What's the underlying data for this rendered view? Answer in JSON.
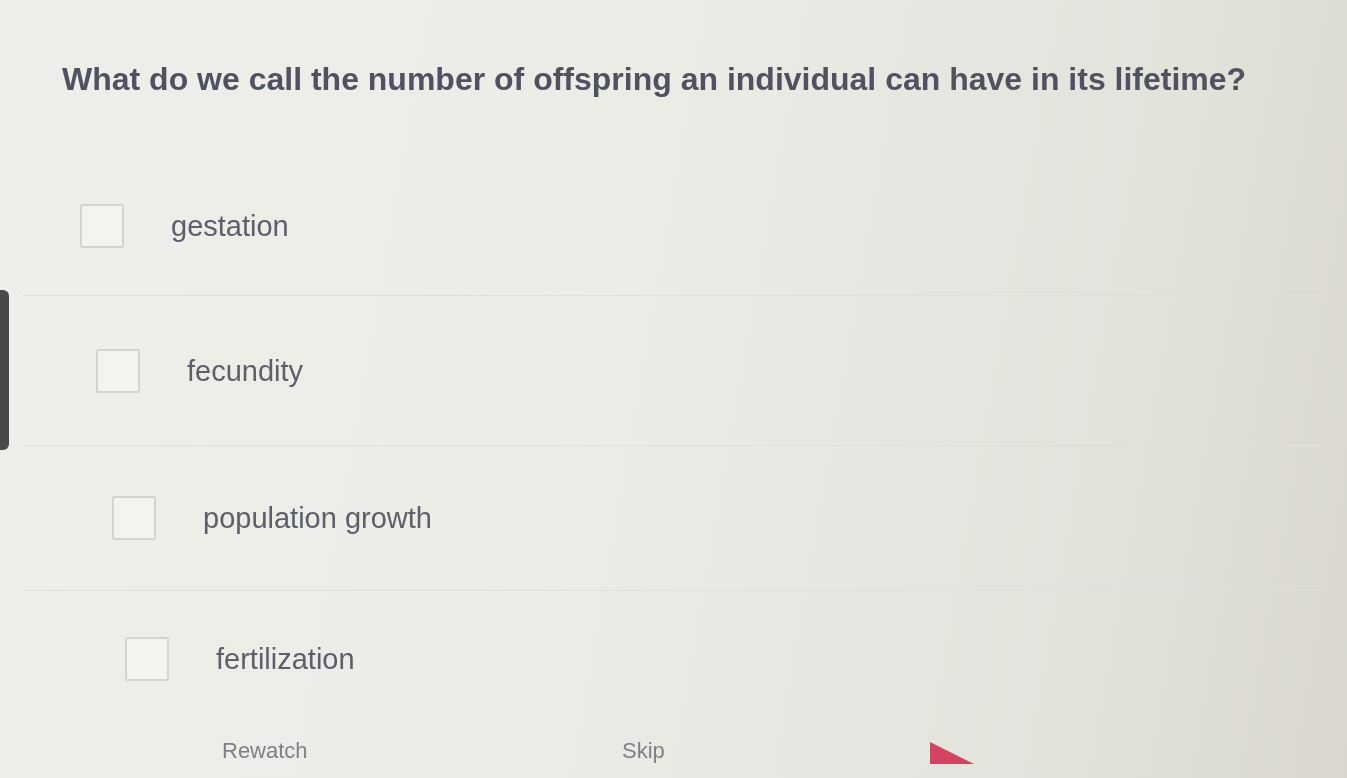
{
  "question": "What do we call the number of offspring an individual can have in its lifetime?",
  "options": [
    {
      "label": "gestation",
      "checked": false
    },
    {
      "label": "fecundity",
      "checked": false
    },
    {
      "label": "population growth",
      "checked": false
    },
    {
      "label": "fertilization",
      "checked": false
    }
  ],
  "actions": [
    {
      "label": "Rewatch",
      "kind": "link"
    },
    {
      "label": "Skip",
      "kind": "link"
    }
  ]
}
